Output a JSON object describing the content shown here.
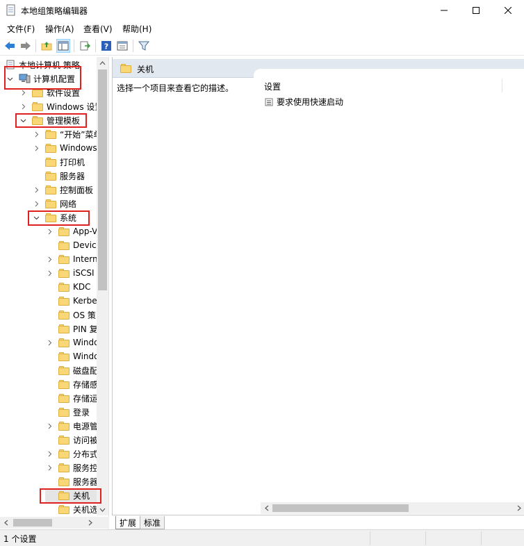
{
  "window": {
    "title": "本地组策略编辑器",
    "minimize_icon": "minimize-icon",
    "maximize_icon": "maximize-icon",
    "close_icon": "close-icon"
  },
  "menu": {
    "items": [
      "文件(F)",
      "操作(A)",
      "查看(V)",
      "帮助(H)"
    ]
  },
  "toolbar": {
    "icons": [
      "back-arrow-icon",
      "forward-arrow-icon",
      "up-folder-icon",
      "show-hide-tree-icon",
      "export-list-icon",
      "help-icon",
      "properties-icon",
      "filter-icon"
    ]
  },
  "tree": {
    "root_label": "本地计算机 策略",
    "computer_config": "计算机配置",
    "software_settings": "软件设置",
    "windows_settings": "Windows 设置",
    "admin_templates": "管理模板",
    "admin_children": [
      "“开始”菜单",
      "Windows",
      "打印机",
      "服务器",
      "控制面板",
      "网络"
    ],
    "system": "系统",
    "system_children": [
      "App-V",
      "Device",
      "Intern",
      "iSCSI",
      "KDC",
      "Kerbe",
      "OS 策",
      "PIN 复",
      "Windo",
      "Windo",
      "磁盘配",
      "存储感",
      "存储运",
      "登录",
      "电源管",
      "访问被",
      "分布式",
      "服务控",
      "服务器",
      "关机",
      "关机选"
    ]
  },
  "right": {
    "header": "关机",
    "description": "选择一个项目来查看它的描述。",
    "settings_column": "设置",
    "setting_item": "要求使用快速启动"
  },
  "tabs": [
    "扩展",
    "标准"
  ],
  "status": {
    "text": "1 个设置"
  },
  "colors": {
    "highlight_box": "#e02020",
    "folder_fill": "#f9d776",
    "header_band": "#e2e8ef"
  }
}
